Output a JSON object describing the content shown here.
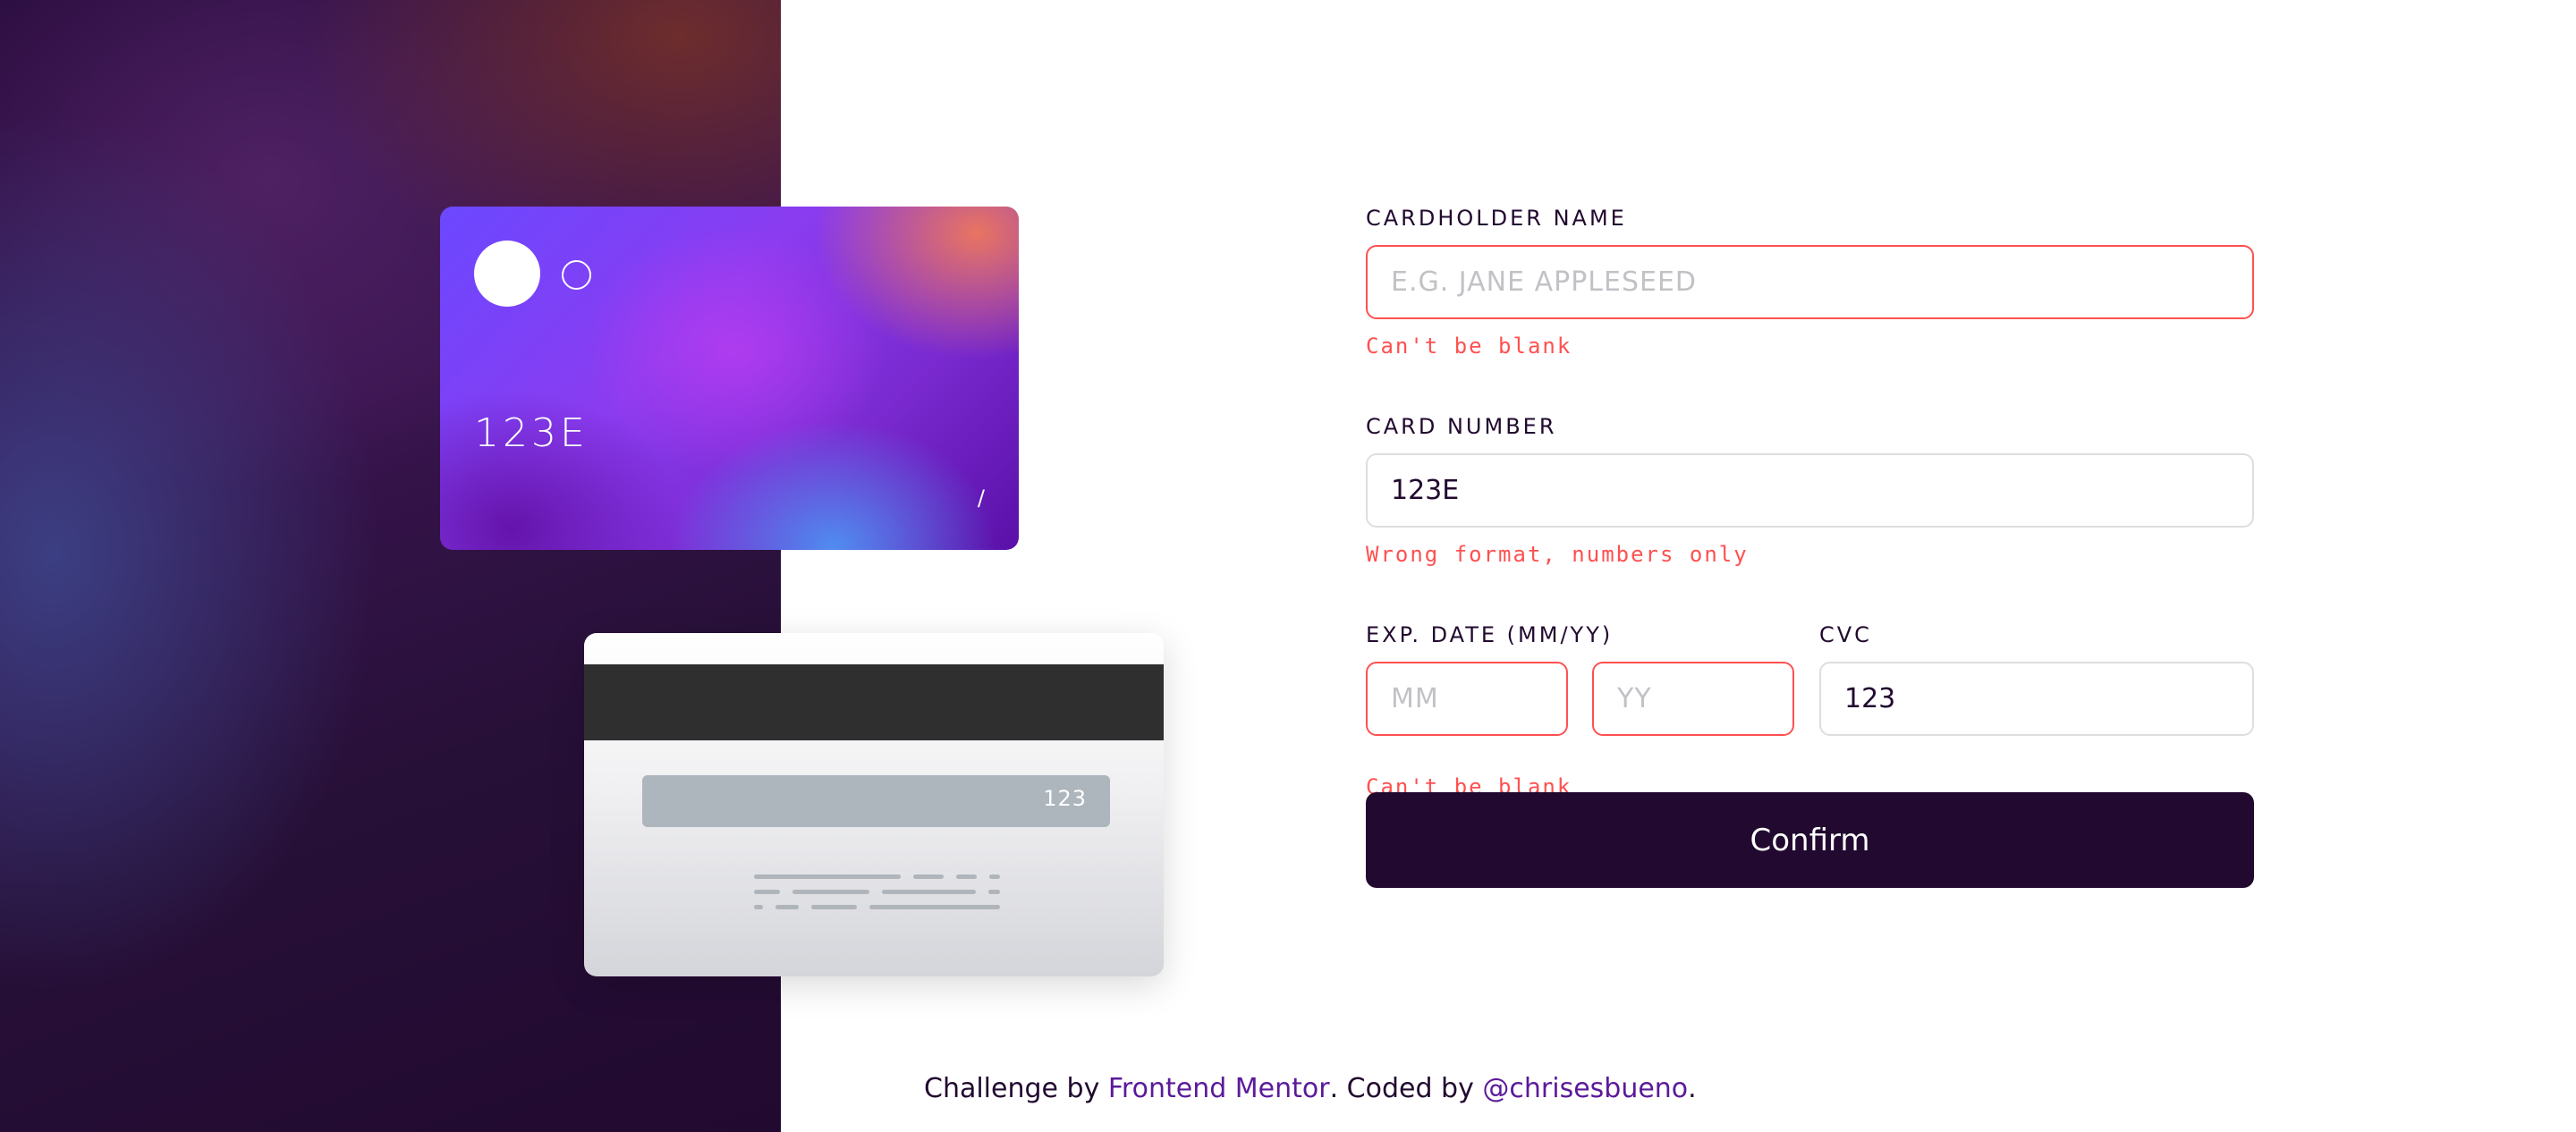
{
  "card_front": {
    "number": "123E",
    "expiry": "/"
  },
  "card_back": {
    "cvc": "123"
  },
  "form": {
    "cardholder": {
      "label": "CARDHOLDER NAME",
      "placeholder": "E.G. JANE APPLESEED",
      "value": "",
      "error": "Can't be blank"
    },
    "number": {
      "label": "CARD NUMBER",
      "value": "123E",
      "error": "Wrong format, numbers only"
    },
    "expiry": {
      "label": "EXP. DATE (MM/YY)",
      "month_placeholder": "MM",
      "year_placeholder": "YY",
      "error": "Can't be blank"
    },
    "cvc": {
      "label": "CVC",
      "value": "123"
    },
    "confirm_label": "Confirm"
  },
  "attribution": {
    "prefix": "Challenge by ",
    "link1": "Frontend Mentor",
    "middle": ". Coded by ",
    "link2": "@chrisesbueno",
    "suffix": "."
  },
  "colors": {
    "dark": "#21092f",
    "error": "#ff5050",
    "border": "#dedddf",
    "link": "#5b1a9a"
  }
}
